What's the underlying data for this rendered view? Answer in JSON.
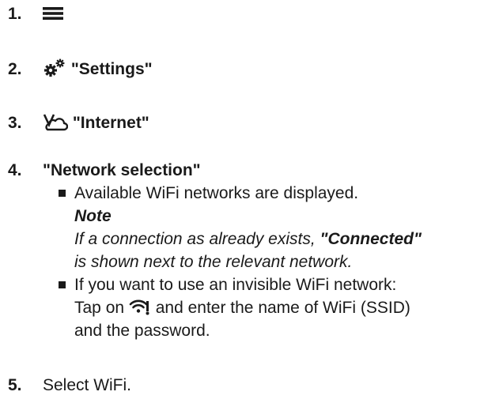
{
  "steps": [
    {
      "number": "1.",
      "icon": "menu-icon"
    },
    {
      "number": "2.",
      "icon": "settings-icon",
      "label": "\"Settings\""
    },
    {
      "number": "3.",
      "icon": "internet-icon",
      "label": "\"Internet\""
    },
    {
      "number": "4.",
      "label": "\"Network selection\""
    },
    {
      "number": "5.",
      "label": "Select WiFi."
    }
  ],
  "step4_bullets": {
    "item1": {
      "text": "Available WiFi networks are displayed.",
      "note_title": "Note",
      "note_line1_prefix": "If a connection as already exists, ",
      "note_connected": "\"Connected\"",
      "note_line2": "is shown next to the relevant network."
    },
    "item2": {
      "line1": "If you want to use an invisible WiFi network:",
      "line2_prefix": "Tap on ",
      "line2_icon": "hidden-wifi-icon",
      "line2_suffix": " and enter the name of WiFi (SSID)",
      "line3": "and the password."
    }
  }
}
